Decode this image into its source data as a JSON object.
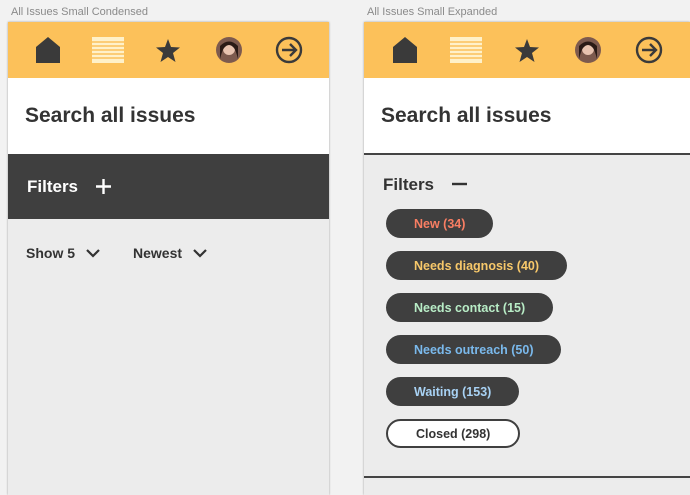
{
  "captions": {
    "condensed": "All Issues Small Condensed",
    "expanded": "All Issues Small Expanded"
  },
  "colors": {
    "navbar": "#fcc15a",
    "dark_bar": "#3f3f3f",
    "chip_new": "#f87e63",
    "chip_diagnosis": "#f7c86a",
    "chip_contact": "#b8ecc6",
    "chip_outreach": "#7ab9ec",
    "chip_waiting": "#a8d2f4"
  },
  "navbar": {
    "items": [
      {
        "name": "home-icon"
      },
      {
        "name": "list-icon"
      },
      {
        "name": "star-icon"
      },
      {
        "name": "avatar"
      },
      {
        "name": "arrow-right-circle-icon"
      }
    ]
  },
  "search": {
    "title": "Search all issues"
  },
  "filters": {
    "label": "Filters",
    "chips": [
      {
        "label": "New (34)",
        "color": "#f87e63"
      },
      {
        "label": "Needs diagnosis (40)",
        "color": "#f7c86a"
      },
      {
        "label": "Needs contact (15)",
        "color": "#b8ecc6"
      },
      {
        "label": "Needs outreach (50)",
        "color": "#7ab9ec"
      },
      {
        "label": "Waiting (153)",
        "color": "#a8d2f4"
      },
      {
        "label": "Closed (298)",
        "color": "#333333"
      }
    ]
  },
  "sort": {
    "show": "Show 5",
    "order": "Newest"
  }
}
